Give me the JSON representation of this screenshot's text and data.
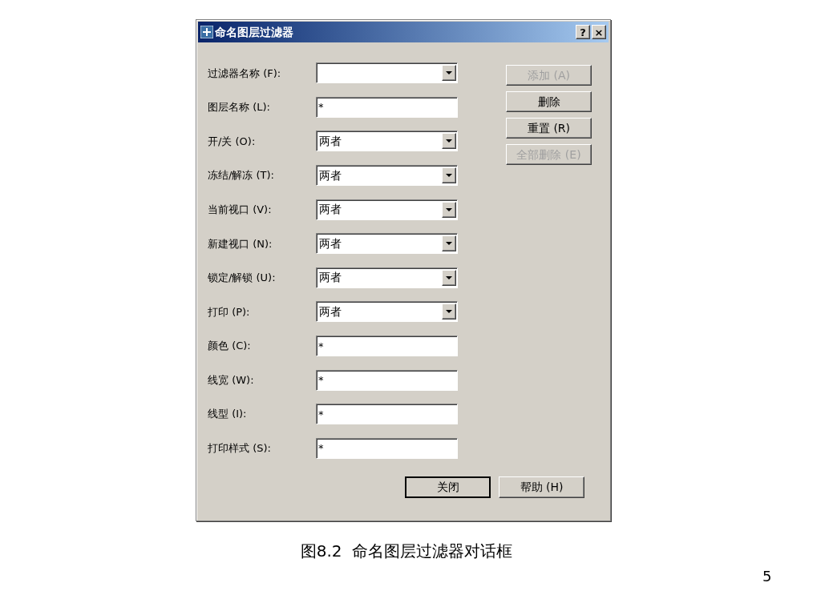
{
  "window": {
    "title": "命名图层过滤器",
    "title_buttons": [
      "?",
      "×"
    ]
  },
  "fields": [
    {
      "label": "过滤器名称 (F):",
      "kind": "dropdown"
    },
    {
      "label": "图层名称 (L):",
      "kind": "text",
      "value": "*"
    },
    {
      "label": "开/关 (O):",
      "kind": "dropdown",
      "value": "两者"
    },
    {
      "label": "冻结/解冻 (T):",
      "kind": "dropdown",
      "value": "两者"
    },
    {
      "label": "当前视口 (V):",
      "kind": "dropdown",
      "value": "两者"
    },
    {
      "label": "新建视口 (N):",
      "kind": "dropdown",
      "value": "两者"
    },
    {
      "label": "锁定/解锁 (U):",
      "kind": "dropdown",
      "value": "两者"
    },
    {
      "label": "打印 (P):",
      "kind": "dropdown",
      "value": "两者"
    },
    {
      "label": "颜色 (C):",
      "kind": "text",
      "value": "*"
    },
    {
      "label": "线宽 (W):",
      "kind": "text",
      "value": "*"
    },
    {
      "label": "线型 (I):",
      "kind": "text",
      "value": "*"
    },
    {
      "label": "打印样式 (S):",
      "kind": "text",
      "value": "*"
    }
  ],
  "side_buttons": [
    {
      "label": "添加 (A)",
      "disabled": true
    },
    {
      "label": "删除",
      "disabled": false
    },
    {
      "label": "重置 (R)",
      "disabled": false
    },
    {
      "label": "全部删除 (E)",
      "disabled": true
    }
  ],
  "footer_buttons": [
    {
      "label": "关闭",
      "default": true
    },
    {
      "label": "帮助 (H)",
      "default": false
    }
  ],
  "caption": "图8.2  命名图层过滤器对话框",
  "page_number": "5"
}
